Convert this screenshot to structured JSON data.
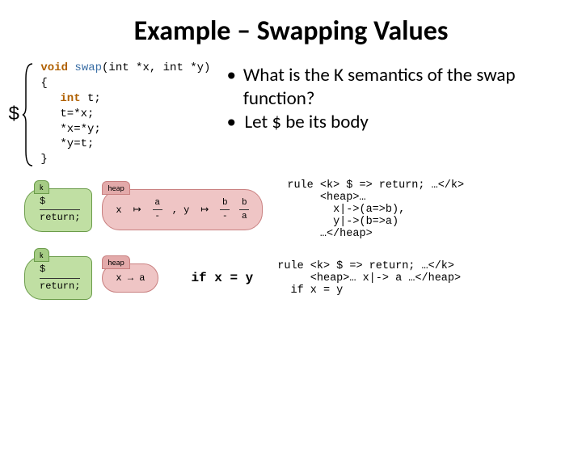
{
  "title": "Example – Swapping Values",
  "dollar": "$",
  "code": {
    "line1_kw": "void",
    "line1_fn": "swap",
    "line1_args": "(int *x, int *y)",
    "open": "{",
    "l2_type": "int",
    "l2_rest": " t;",
    "l3": "t=*x;",
    "l4": "*x=*y;",
    "l5": "*y=t;",
    "close": "}"
  },
  "bullets": {
    "b1": "What is the K semantics of the swap function?",
    "b2": "Let $ be its body"
  },
  "diag1": {
    "k": {
      "label": "k",
      "top": "$",
      "bot": "return;"
    },
    "heap": {
      "label": "heap",
      "lhs": "x",
      "p1_top": "a",
      "p1_bot": "-",
      "mid": ", y",
      "p2_top": "b",
      "p2_bot": "-",
      "p3_top": "b",
      "p3_bot": "a"
    },
    "rule": "rule <k> $ => return; …</k>\n     <heap>…\n       x|->(a=>b),\n       y|->(b=>a)\n     …</heap>"
  },
  "diag2": {
    "k": {
      "label": "k",
      "top": "$",
      "bot": "return;"
    },
    "heap": {
      "label": "heap",
      "content": "x → a"
    },
    "cond_kw": "if",
    "cond": "x = y",
    "rule": "rule <k> $ => return; …</k>\n     <heap>… x|-> a …</heap>\n  if x = y"
  }
}
